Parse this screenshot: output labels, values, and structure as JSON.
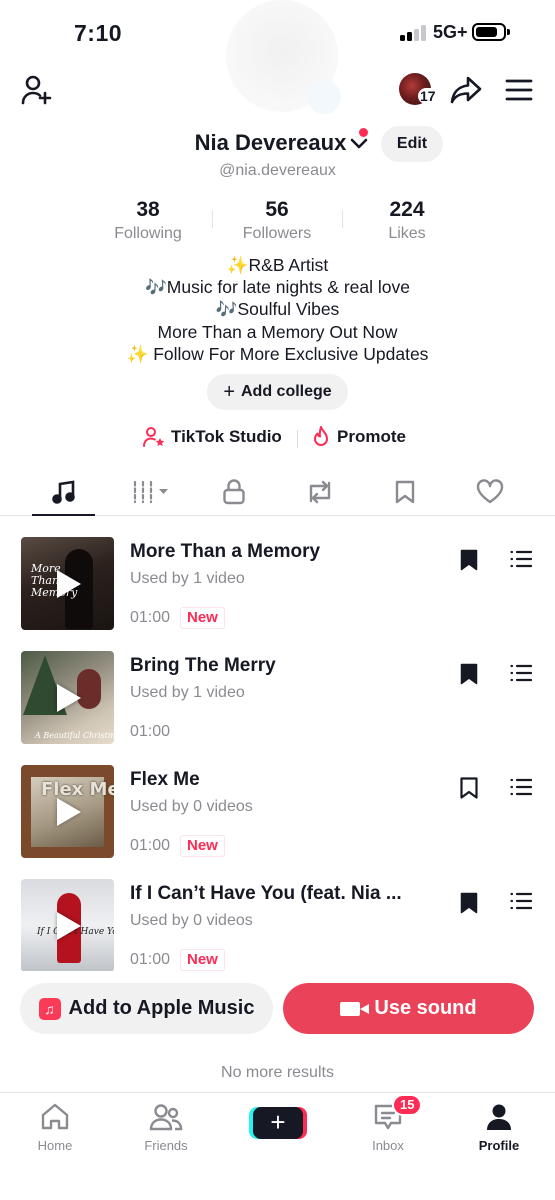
{
  "status_bar": {
    "time": "7:10",
    "network": "5G+",
    "battery_level": 0.8
  },
  "header": {
    "story_count": "17",
    "name": "Nia Devereaux",
    "username": "@nia.devereaux",
    "edit_label": "Edit"
  },
  "stats": [
    {
      "value": "38",
      "label": "Following"
    },
    {
      "value": "56",
      "label": "Followers"
    },
    {
      "value": "224",
      "label": "Likes"
    }
  ],
  "bio": {
    "lines": [
      "✨R&B Artist",
      "🎶Music for late nights & real love",
      "🎶Soulful Vibes",
      "More Than a Memory Out Now",
      "✨ Follow For More Exclusive Updates"
    ]
  },
  "college_button": {
    "plus": "+",
    "label": "Add college"
  },
  "quick_links": {
    "studio": "TikTok Studio",
    "promote": "Promote"
  },
  "tabs": [
    "music-icon",
    "grid-filter-icon",
    "lock-icon",
    "repost-icon",
    "bookmark-icon",
    "heart-icon"
  ],
  "sounds": [
    {
      "title": "More Than a Memory",
      "used": "Used by 1 video",
      "duration": "01:00",
      "badge": "New",
      "saved": true,
      "cover_caption": "More Than a Memory"
    },
    {
      "title": "Bring The Merry",
      "used": "Used by 1 video",
      "duration": "01:00",
      "badge": "",
      "saved": true,
      "cover_caption": "A Beautiful Christmas"
    },
    {
      "title": "Flex Me",
      "used": "Used by 0 videos",
      "duration": "01:00",
      "badge": "New",
      "saved": false,
      "cover_caption": "Flex Me"
    },
    {
      "title": "If I Can’t Have You (feat. Nia ...",
      "used": "Used by 0 videos",
      "duration": "01:00",
      "badge": "New",
      "saved": true,
      "cover_caption": "If I Can’t Have You"
    }
  ],
  "actions": {
    "apple_music": "Add to Apple Music",
    "use_sound": "Use sound"
  },
  "no_more": "No more results",
  "nav": {
    "home": "Home",
    "friends": "Friends",
    "create": "+",
    "inbox": "Inbox",
    "inbox_badge": "15",
    "profile": "Profile"
  },
  "colors": {
    "accent": "#fe2c55",
    "use_sound_button": "#ea4359",
    "text": "#161823",
    "muted": "#8a8b91"
  }
}
